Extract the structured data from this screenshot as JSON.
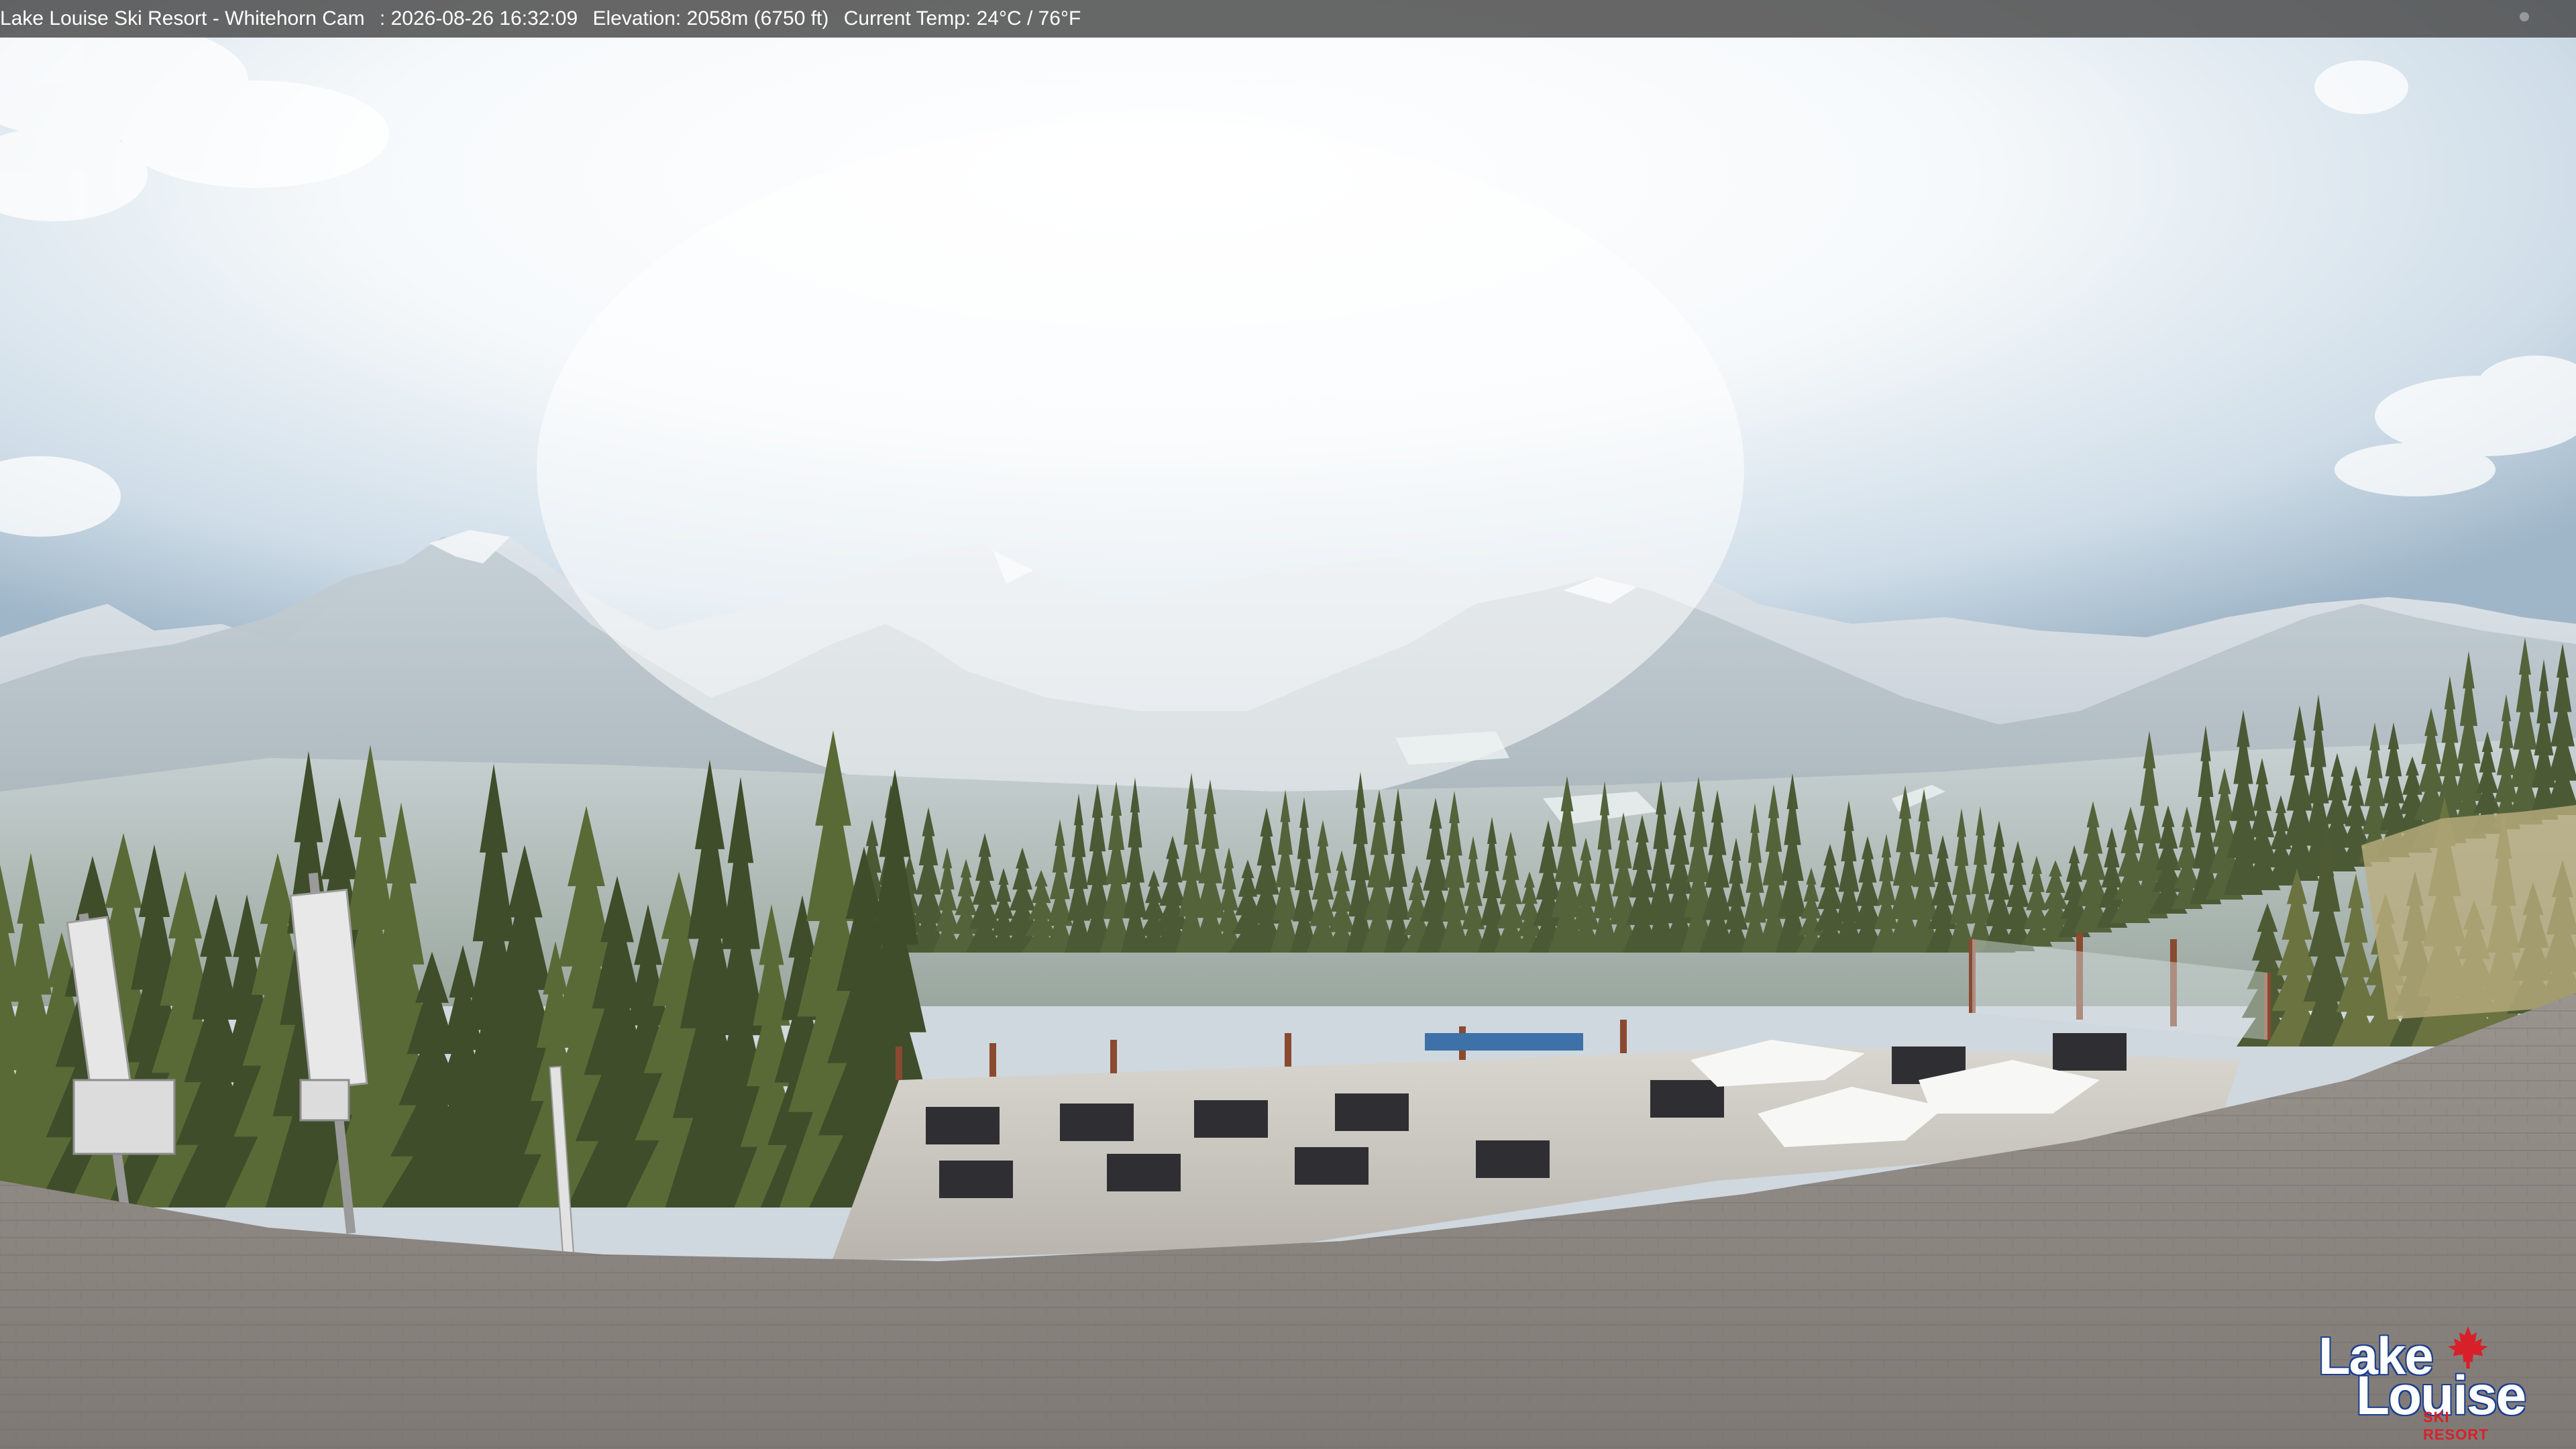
{
  "overlay": {
    "camera_title": "Lake Louise Ski Resort - Whitehorn Cam",
    "timestamp": ": 2026-08-26 16:32:09",
    "elevation": "Elevation: 2058m (6750 ft)",
    "temperature": "Current Temp: 24°C / 76°F"
  },
  "logo": {
    "line1": "Lake",
    "line2": "Louise",
    "line3": "SKI RESORT",
    "icon": "maple-leaf-icon"
  },
  "colors": {
    "sky": "#dfe9f0",
    "mountains": "#bfcad3",
    "forest": "#4d5a33",
    "roof": "#8d8783",
    "logo_red": "#d8202a",
    "logo_blue": "#1a3f8f"
  }
}
